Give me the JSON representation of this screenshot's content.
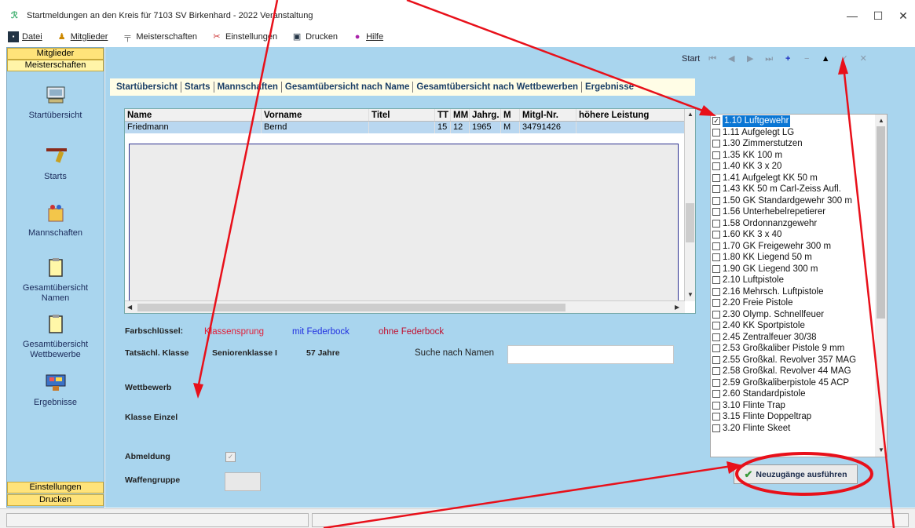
{
  "window": {
    "title": "Startmeldungen an den Kreis für 7103 SV Birkenhard - 2022   Veranstaltung",
    "minimize": "—",
    "maximize": "☐",
    "close": "✕"
  },
  "menu": [
    {
      "label": "Datei",
      "icon": "save-icon"
    },
    {
      "label": "Mitglieder",
      "icon": "person-icon"
    },
    {
      "label": "Meisterschaften",
      "icon": "rifle-icon"
    },
    {
      "label": "Einstellungen",
      "icon": "tools-icon"
    },
    {
      "label": "Drucken",
      "icon": "printer-icon"
    },
    {
      "label": "Hilfe",
      "icon": "help-icon"
    }
  ],
  "sidebar": {
    "top_headers": [
      "Mitglieder",
      "Meisterschaften"
    ],
    "items": [
      {
        "label": "Startübersicht",
        "icon": "overview-icon"
      },
      {
        "label": "Starts",
        "icon": "pistol-icon"
      },
      {
        "label": "Mannschaften",
        "icon": "team-icon"
      },
      {
        "label": "Gesamtübersicht\nNamen",
        "icon": "clipboard-icon"
      },
      {
        "label": "Gesamtübersicht\nWettbewerbe",
        "icon": "clipboard-icon"
      },
      {
        "label": "Ergebnisse",
        "icon": "results-icon"
      }
    ],
    "bottom_headers": [
      "Einstellungen",
      "Drucken"
    ]
  },
  "navbar": {
    "label": "Start",
    "buttons": [
      "⏮",
      "◀",
      "▶",
      "⏭",
      "+",
      "−",
      "▲",
      "✓",
      "✕"
    ]
  },
  "tabs": [
    "Startübersicht",
    "Starts",
    "Mannschaften",
    "Gesamtübersicht nach Name",
    "Gesamtübersicht nach Wettbewerben",
    "Ergebnisse"
  ],
  "table": {
    "columns": [
      "Name",
      "Vorname",
      "Titel",
      "TT",
      "MM",
      "Jahrg.",
      "M",
      "Mitgl-Nr.",
      "höhere Leistung"
    ],
    "rows": [
      [
        "Friedmann",
        "Bernd",
        "",
        "15",
        "12",
        "1965",
        "M",
        "34791426",
        ""
      ]
    ]
  },
  "form": {
    "farbschluessel_label": "Farbschlüssel:",
    "color_keys": [
      {
        "text": "Klassensprung",
        "color": "#e0203a"
      },
      {
        "text": "mit Federbock",
        "color": "#2030e0"
      },
      {
        "text": "ohne Federbock",
        "color": "#c01030"
      }
    ],
    "klasse_label": "Tatsächl. Klasse",
    "klasse_value": "Seniorenklasse I",
    "age_value": "57 Jahre",
    "search_label": "Suche nach Namen",
    "search_value": "",
    "wettbewerb_label": "Wettbewerb",
    "klasse_einzel_label": "Klasse Einzel",
    "abmeldung_label": "Abmeldung",
    "waffengruppe_label": "Waffengruppe"
  },
  "competitions": [
    {
      "label": "1.10 Luftgewehr",
      "checked": true
    },
    {
      "label": "1.11 Aufgelegt LG",
      "checked": false
    },
    {
      "label": "1.30 Zimmerstutzen",
      "checked": false
    },
    {
      "label": "1.35 KK 100 m",
      "checked": false
    },
    {
      "label": "1.40 KK 3 x 20",
      "checked": false
    },
    {
      "label": "1.41 Aufgelegt KK 50 m",
      "checked": false
    },
    {
      "label": "1.43 KK 50 m Carl-Zeiss Aufl.",
      "checked": false
    },
    {
      "label": "1.50 GK Standardgewehr 300 m",
      "checked": false
    },
    {
      "label": "1.56 Unterhebelrepetierer",
      "checked": false
    },
    {
      "label": "1.58 Ordonnanzgewehr",
      "checked": false
    },
    {
      "label": "1.60 KK 3 x 40",
      "checked": false
    },
    {
      "label": "1.70 GK Freigewehr 300 m",
      "checked": false
    },
    {
      "label": "1.80 KK Liegend 50 m",
      "checked": false
    },
    {
      "label": "1.90 GK Liegend 300 m",
      "checked": false
    },
    {
      "label": "2.10 Luftpistole",
      "checked": false
    },
    {
      "label": "2.16 Mehrsch. Luftpistole",
      "checked": false
    },
    {
      "label": "2.20 Freie Pistole",
      "checked": false
    },
    {
      "label": "2.30 Olymp. Schnellfeuer",
      "checked": false
    },
    {
      "label": "2.40 KK Sportpistole",
      "checked": false
    },
    {
      "label": "2.45 Zentralfeuer 30/38",
      "checked": false
    },
    {
      "label": "2.53 Großkaliber Pistole 9 mm",
      "checked": false
    },
    {
      "label": "2.55 Großkal. Revolver 357 MAG",
      "checked": false
    },
    {
      "label": "2.58 Großkal. Revolver 44 MAG",
      "checked": false
    },
    {
      "label": "2.59 Großkaliberpistole 45 ACP",
      "checked": false
    },
    {
      "label": "2.60 Standardpistole",
      "checked": false
    },
    {
      "label": "3.10 Flinte Trap",
      "checked": false
    },
    {
      "label": "3.15 Flinte Doppeltrap",
      "checked": false
    },
    {
      "label": "3.20 Flinte Skeet",
      "checked": false
    }
  ],
  "neuzugaenge_button": "Neuzugänge ausführen",
  "colors": {
    "panel": "#a9d5ee",
    "header_yellow": "#ffe37a",
    "annotation_red": "#e8101a",
    "selection": "#0a76d4"
  }
}
